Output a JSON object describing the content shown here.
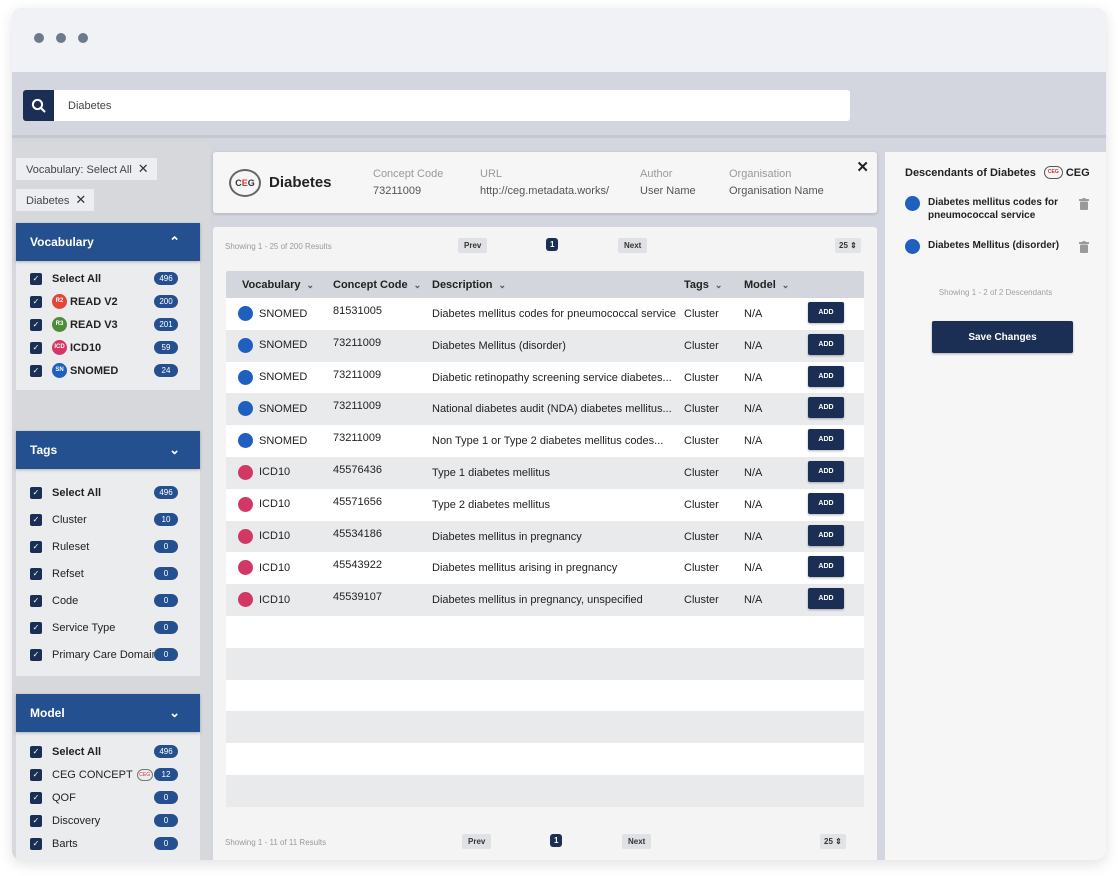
{
  "window": {
    "controls": [
      "dot",
      "dot",
      "dot"
    ]
  },
  "search": {
    "value": "Diabetes",
    "placeholder": "Search",
    "icon": "search-icon"
  },
  "filters": {
    "chips": [
      {
        "label": "Vocabulary: Select All",
        "close": "✕"
      },
      {
        "label": "Diabetes",
        "close": "✕"
      }
    ]
  },
  "sidebar": {
    "vocabulary": {
      "title": "Vocabulary",
      "expanded": true,
      "chevron": "^",
      "options": [
        {
          "label": "Select All",
          "count": "496",
          "checked": true
        },
        {
          "label": "READ V2",
          "count": "200",
          "checked": true,
          "badge": "R2"
        },
        {
          "label": "READ V3",
          "count": "201",
          "checked": true,
          "badge": "R3"
        },
        {
          "label": "ICD10",
          "count": "59",
          "checked": true,
          "badge": "ICD"
        },
        {
          "label": "SNOMED",
          "count": "24",
          "checked": true,
          "badge": "SN"
        }
      ]
    },
    "tags": {
      "title": "Tags",
      "expanded": false,
      "chevron": "⌄",
      "options": [
        {
          "label": "Select All",
          "count": "496",
          "checked": true
        },
        {
          "label": "Cluster",
          "count": "10",
          "checked": true
        },
        {
          "label": "Ruleset",
          "count": "0",
          "checked": true
        },
        {
          "label": "Refset",
          "count": "0",
          "checked": true
        },
        {
          "label": "Code",
          "count": "0",
          "checked": true
        },
        {
          "label": "Service Type",
          "count": "0",
          "checked": true
        },
        {
          "label": "Primary Care Domain",
          "count": "0",
          "checked": true
        }
      ]
    },
    "model": {
      "title": "Model",
      "expanded": false,
      "chevron": "⌄",
      "options": [
        {
          "label": "Select All",
          "count": "496",
          "checked": true
        },
        {
          "label": "CEG CONCEPT",
          "count": "12",
          "checked": true,
          "badge": "CEG"
        },
        {
          "label": "QOF",
          "count": "0",
          "checked": true
        },
        {
          "label": "Discovery",
          "count": "0",
          "checked": true
        },
        {
          "label": "Barts",
          "count": "0",
          "checked": true
        }
      ]
    }
  },
  "concept": {
    "logo": "CEG",
    "title": "Diabetes",
    "fields": [
      {
        "label": "Concept Code",
        "value": "73211009"
      },
      {
        "label": "URL",
        "value": "http://ceg.metadata.works/"
      },
      {
        "label": "Author",
        "value": "User Name"
      },
      {
        "label": "Organisation",
        "value": "Organisation Name"
      }
    ],
    "close": "✕"
  },
  "results": {
    "top_pager": {
      "showing": "Showing 1 - 25 of 200 Results",
      "prev": "Prev",
      "page": "1",
      "next": "Next",
      "page_size": "25 ⇕"
    },
    "bottom_pager": {
      "showing": "Showing 1 - 11 of 11 Results",
      "prev": "Prev",
      "page": "1",
      "next": "Next",
      "page_size": "25 ⇕"
    },
    "columns": [
      {
        "label": "Vocabulary",
        "arrow": "⌄"
      },
      {
        "label": "Concept Code",
        "arrow": "⌄"
      },
      {
        "label": "Description",
        "arrow": "⌄"
      },
      {
        "label": "Tags",
        "arrow": "⌄"
      },
      {
        "label": "Model",
        "arrow": "⌄"
      }
    ],
    "add_label": "ADD",
    "rows": [
      {
        "vocabulary": "SNOMED",
        "code": "81531005",
        "description": "Diabetes mellitus codes for pneumococcal service",
        "tags": "Cluster",
        "model": "N/A"
      },
      {
        "vocabulary": "SNOMED",
        "code": "73211009",
        "description": "Diabetes Mellitus (disorder)",
        "tags": "Cluster",
        "model": "N/A"
      },
      {
        "vocabulary": "SNOMED",
        "code": "73211009",
        "description": "Diabetic retinopathy screening service diabetes...",
        "tags": "Cluster",
        "model": "N/A"
      },
      {
        "vocabulary": "SNOMED",
        "code": "73211009",
        "description": "National diabetes audit (NDA) diabetes mellitus...",
        "tags": "Cluster",
        "model": "N/A"
      },
      {
        "vocabulary": "SNOMED",
        "code": "73211009",
        "description": "Non Type 1 or Type 2 diabetes mellitus codes...",
        "tags": "Cluster",
        "model": "N/A"
      },
      {
        "vocabulary": "ICD10",
        "code": "45576436",
        "description": "Type 1 diabetes mellitus",
        "tags": "Cluster",
        "model": "N/A"
      },
      {
        "vocabulary": "ICD10",
        "code": "45571656",
        "description": "Type 2 diabetes mellitus",
        "tags": "Cluster",
        "model": "N/A"
      },
      {
        "vocabulary": "ICD10",
        "code": "45534186",
        "description": "Diabetes mellitus in pregnancy",
        "tags": "Cluster",
        "model": "N/A"
      },
      {
        "vocabulary": "ICD10",
        "code": "45543922",
        "description": "Diabetes mellitus arising in pregnancy",
        "tags": "Cluster",
        "model": "N/A"
      },
      {
        "vocabulary": "ICD10",
        "code": "45539107",
        "description": "Diabetes mellitus in pregnancy, unspecified",
        "tags": "Cluster",
        "model": "N/A"
      }
    ]
  },
  "descendants": {
    "title": "Descendants of Diabetes",
    "badge": "CEG",
    "badge_logo": "CEG",
    "items": [
      {
        "vocabulary": "SNOMED",
        "label": "Diabetes mellitus codes for pneumococcal service"
      },
      {
        "vocabulary": "SNOMED",
        "label": "Diabetes Mellitus (disorder)"
      }
    ],
    "showing": "Showing 1 - 2 of 2 Descendants",
    "save_label": "Save Changes"
  },
  "colors": {
    "navy": "#1b2f55",
    "accent_blue": "#25508f",
    "read_v2": "#e3453b",
    "read_v3": "#4d8d3a",
    "icd10": "#d23866",
    "snomed": "#1f5fbf"
  }
}
